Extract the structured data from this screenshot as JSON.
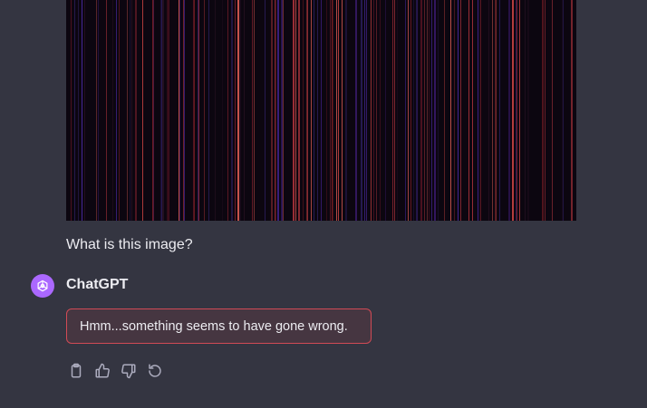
{
  "conversation": {
    "user_message": {
      "text": "What is this image?",
      "attachment": "image"
    },
    "assistant": {
      "name": "ChatGPT",
      "avatar_icon": "openai-logo-icon",
      "avatar_color": "#ab68ff",
      "error_text": "Hmm...something seems to have gone wrong.",
      "error_border_color": "#d14a55"
    },
    "actions": [
      {
        "icon": "clipboard-icon"
      },
      {
        "icon": "thumbs-up-icon"
      },
      {
        "icon": "thumbs-down-icon"
      },
      {
        "icon": "regenerate-icon"
      }
    ]
  },
  "theme": {
    "background": "#343541",
    "text": "#ececf1",
    "icon": "#acacbe"
  }
}
